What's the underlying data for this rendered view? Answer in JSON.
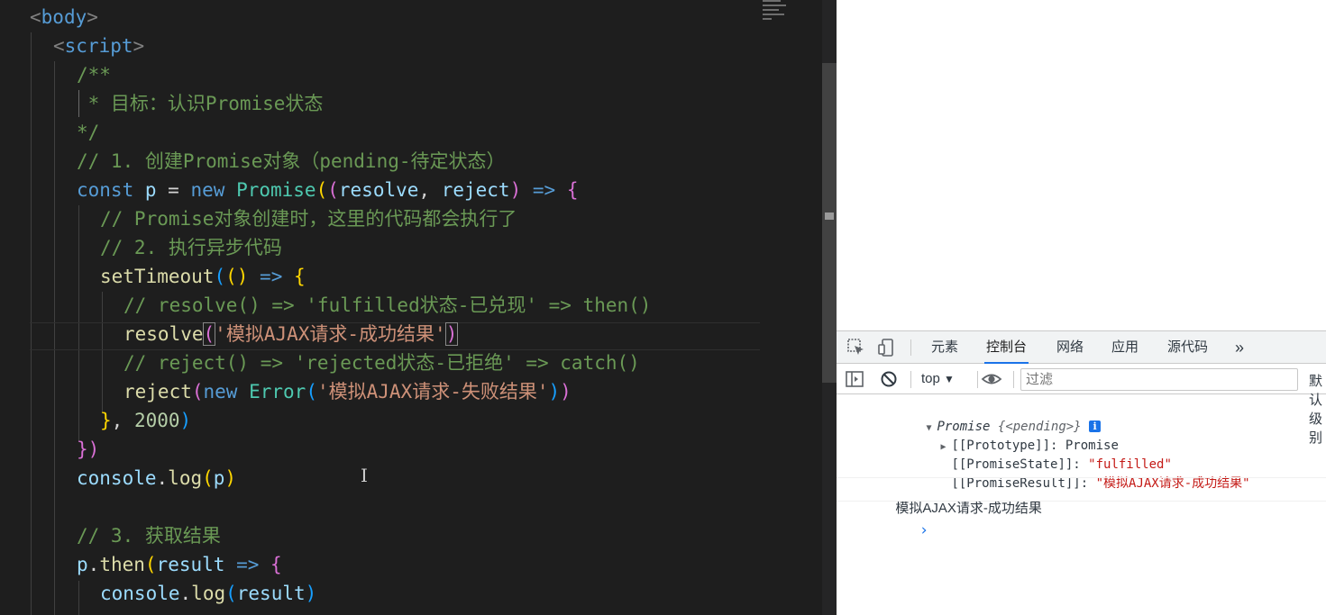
{
  "editor": {
    "lines": [
      [
        {
          "t": "<",
          "c": "t-br"
        },
        {
          "t": "body",
          "c": "t-tag"
        },
        {
          "t": ">",
          "c": "t-br"
        }
      ],
      [
        {
          "t": "<",
          "c": "t-br"
        },
        {
          "t": "script",
          "c": "t-tag"
        },
        {
          "t": ">",
          "c": "t-br"
        }
      ],
      [
        {
          "t": "/**",
          "c": "t-cm"
        }
      ],
      [
        {
          "t": " * 目标：认识Promise状态",
          "c": "t-cm"
        }
      ],
      [
        {
          "t": "*/",
          "c": "t-cm"
        }
      ],
      [
        {
          "t": "// 1. 创建Promise对象（pending-待定状态）",
          "c": "t-cm"
        }
      ],
      [
        {
          "t": "const",
          "c": "t-kw"
        },
        {
          "t": " ",
          "c": "t-op"
        },
        {
          "t": "p",
          "c": "t-var"
        },
        {
          "t": " = ",
          "c": "t-op"
        },
        {
          "t": "new",
          "c": "t-kw"
        },
        {
          "t": " ",
          "c": "t-op"
        },
        {
          "t": "Promise",
          "c": "t-cls"
        },
        {
          "t": "(",
          "c": "t-p1"
        },
        {
          "t": "(",
          "c": "t-p2"
        },
        {
          "t": "resolve",
          "c": "t-var"
        },
        {
          "t": ", ",
          "c": "t-op"
        },
        {
          "t": "reject",
          "c": "t-var"
        },
        {
          "t": ")",
          "c": "t-p2"
        },
        {
          "t": " ",
          "c": "t-op"
        },
        {
          "t": "=>",
          "c": "t-kw"
        },
        {
          "t": " ",
          "c": "t-op"
        },
        {
          "t": "{",
          "c": "t-p2"
        }
      ],
      [
        {
          "t": "// Promise对象创建时，这里的代码都会执行了",
          "c": "t-cm"
        }
      ],
      [
        {
          "t": "// 2. 执行异步代码",
          "c": "t-cm"
        }
      ],
      [
        {
          "t": "setTimeout",
          "c": "t-fn"
        },
        {
          "t": "(",
          "c": "t-p3"
        },
        {
          "t": "()",
          "c": "t-p1"
        },
        {
          "t": " ",
          "c": "t-op"
        },
        {
          "t": "=>",
          "c": "t-kw"
        },
        {
          "t": " ",
          "c": "t-op"
        },
        {
          "t": "{",
          "c": "t-p1"
        }
      ],
      [
        {
          "t": "// resolve() => 'fulfilled状态-已兑现' => then()",
          "c": "t-cm"
        }
      ],
      [
        {
          "t": "resolve",
          "c": "t-fn"
        },
        {
          "t": "(",
          "c": "t-p2 match-br"
        },
        {
          "t": "'模拟AJAX请求-成功结果'",
          "c": "t-str"
        },
        {
          "t": ")",
          "c": "t-p2 match-br"
        }
      ],
      [
        {
          "t": "// reject() => 'rejected状态-已拒绝' => catch()",
          "c": "t-cm"
        }
      ],
      [
        {
          "t": "reject",
          "c": "t-fn"
        },
        {
          "t": "(",
          "c": "t-p2"
        },
        {
          "t": "new",
          "c": "t-kw"
        },
        {
          "t": " ",
          "c": "t-op"
        },
        {
          "t": "Error",
          "c": "t-cls"
        },
        {
          "t": "(",
          "c": "t-p3"
        },
        {
          "t": "'模拟AJAX请求-失败结果'",
          "c": "t-str"
        },
        {
          "t": ")",
          "c": "t-p3"
        },
        {
          "t": ")",
          "c": "t-p2"
        }
      ],
      [
        {
          "t": "}",
          "c": "t-p1"
        },
        {
          "t": ", ",
          "c": "t-op"
        },
        {
          "t": "2000",
          "c": "t-num"
        },
        {
          "t": ")",
          "c": "t-p3"
        }
      ],
      [
        {
          "t": "})",
          "c": "t-p2"
        }
      ],
      [
        {
          "t": "console",
          "c": "t-var"
        },
        {
          "t": ".",
          "c": "t-op"
        },
        {
          "t": "log",
          "c": "t-fn"
        },
        {
          "t": "(",
          "c": "t-p1"
        },
        {
          "t": "p",
          "c": "t-var"
        },
        {
          "t": ")",
          "c": "t-p1"
        }
      ],
      [],
      [
        {
          "t": "// 3. 获取结果",
          "c": "t-cm"
        }
      ],
      [
        {
          "t": "p",
          "c": "t-var"
        },
        {
          "t": ".",
          "c": "t-op"
        },
        {
          "t": "then",
          "c": "t-fn"
        },
        {
          "t": "(",
          "c": "t-p1"
        },
        {
          "t": "result",
          "c": "t-var"
        },
        {
          "t": " ",
          "c": "t-op"
        },
        {
          "t": "=>",
          "c": "t-kw"
        },
        {
          "t": " ",
          "c": "t-op"
        },
        {
          "t": "{",
          "c": "t-p2"
        }
      ],
      [
        {
          "t": "console",
          "c": "t-var"
        },
        {
          "t": ".",
          "c": "t-op"
        },
        {
          "t": "log",
          "c": "t-fn"
        },
        {
          "t": "(",
          "c": "t-p3"
        },
        {
          "t": "result",
          "c": "t-var"
        },
        {
          "t": ")",
          "c": "t-p3"
        }
      ]
    ]
  },
  "devtools": {
    "tabs": [
      "元素",
      "控制台",
      "网络",
      "应用",
      "源代码"
    ],
    "active_tab": "控制台",
    "more_tabs": "»",
    "context": "top",
    "filter_placeholder": "过滤",
    "levels_label": "默认级别"
  },
  "console": {
    "promise_label": "Promise",
    "promise_state_preview": "{<pending>}",
    "info_badge": "i",
    "prototype_key": "[[Prototype]]: ",
    "prototype_val": "Promise",
    "state_key": "[[PromiseState]]: ",
    "state_val": "\"fulfilled\"",
    "result_key": "[[PromiseResult]]: ",
    "result_val": "\"模拟AJAX请求-成功结果\"",
    "log_line": "模拟AJAX请求-成功结果",
    "prompt": "›"
  },
  "colors": {
    "editor_bg": "#1e1e1e",
    "comment": "#6a9955",
    "keyword": "#569cd6",
    "string": "#ce9178",
    "devtools_accent": "#1a73e8",
    "console_string": "#c41a16"
  }
}
